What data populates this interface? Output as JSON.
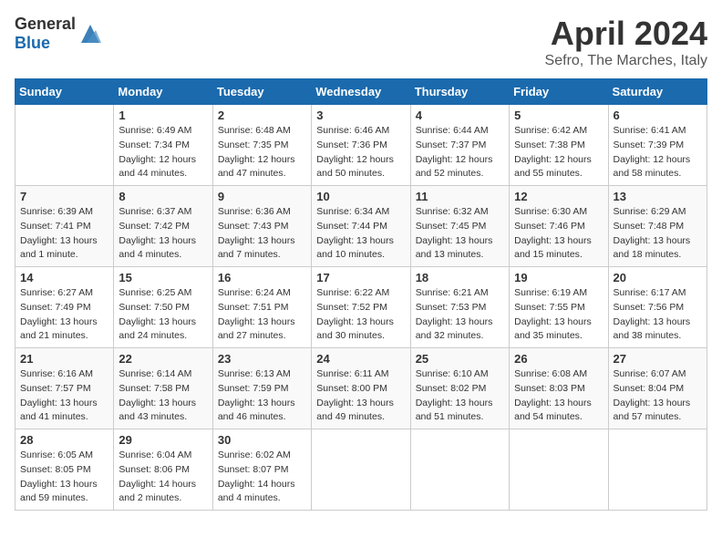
{
  "header": {
    "logo_general": "General",
    "logo_blue": "Blue",
    "month_year": "April 2024",
    "location": "Sefro, The Marches, Italy"
  },
  "weekdays": [
    "Sunday",
    "Monday",
    "Tuesday",
    "Wednesday",
    "Thursday",
    "Friday",
    "Saturday"
  ],
  "weeks": [
    [
      {
        "day": "",
        "sunrise": "",
        "sunset": "",
        "daylight": ""
      },
      {
        "day": "1",
        "sunrise": "Sunrise: 6:49 AM",
        "sunset": "Sunset: 7:34 PM",
        "daylight": "Daylight: 12 hours and 44 minutes."
      },
      {
        "day": "2",
        "sunrise": "Sunrise: 6:48 AM",
        "sunset": "Sunset: 7:35 PM",
        "daylight": "Daylight: 12 hours and 47 minutes."
      },
      {
        "day": "3",
        "sunrise": "Sunrise: 6:46 AM",
        "sunset": "Sunset: 7:36 PM",
        "daylight": "Daylight: 12 hours and 50 minutes."
      },
      {
        "day": "4",
        "sunrise": "Sunrise: 6:44 AM",
        "sunset": "Sunset: 7:37 PM",
        "daylight": "Daylight: 12 hours and 52 minutes."
      },
      {
        "day": "5",
        "sunrise": "Sunrise: 6:42 AM",
        "sunset": "Sunset: 7:38 PM",
        "daylight": "Daylight: 12 hours and 55 minutes."
      },
      {
        "day": "6",
        "sunrise": "Sunrise: 6:41 AM",
        "sunset": "Sunset: 7:39 PM",
        "daylight": "Daylight: 12 hours and 58 minutes."
      }
    ],
    [
      {
        "day": "7",
        "sunrise": "Sunrise: 6:39 AM",
        "sunset": "Sunset: 7:41 PM",
        "daylight": "Daylight: 13 hours and 1 minute."
      },
      {
        "day": "8",
        "sunrise": "Sunrise: 6:37 AM",
        "sunset": "Sunset: 7:42 PM",
        "daylight": "Daylight: 13 hours and 4 minutes."
      },
      {
        "day": "9",
        "sunrise": "Sunrise: 6:36 AM",
        "sunset": "Sunset: 7:43 PM",
        "daylight": "Daylight: 13 hours and 7 minutes."
      },
      {
        "day": "10",
        "sunrise": "Sunrise: 6:34 AM",
        "sunset": "Sunset: 7:44 PM",
        "daylight": "Daylight: 13 hours and 10 minutes."
      },
      {
        "day": "11",
        "sunrise": "Sunrise: 6:32 AM",
        "sunset": "Sunset: 7:45 PM",
        "daylight": "Daylight: 13 hours and 13 minutes."
      },
      {
        "day": "12",
        "sunrise": "Sunrise: 6:30 AM",
        "sunset": "Sunset: 7:46 PM",
        "daylight": "Daylight: 13 hours and 15 minutes."
      },
      {
        "day": "13",
        "sunrise": "Sunrise: 6:29 AM",
        "sunset": "Sunset: 7:48 PM",
        "daylight": "Daylight: 13 hours and 18 minutes."
      }
    ],
    [
      {
        "day": "14",
        "sunrise": "Sunrise: 6:27 AM",
        "sunset": "Sunset: 7:49 PM",
        "daylight": "Daylight: 13 hours and 21 minutes."
      },
      {
        "day": "15",
        "sunrise": "Sunrise: 6:25 AM",
        "sunset": "Sunset: 7:50 PM",
        "daylight": "Daylight: 13 hours and 24 minutes."
      },
      {
        "day": "16",
        "sunrise": "Sunrise: 6:24 AM",
        "sunset": "Sunset: 7:51 PM",
        "daylight": "Daylight: 13 hours and 27 minutes."
      },
      {
        "day": "17",
        "sunrise": "Sunrise: 6:22 AM",
        "sunset": "Sunset: 7:52 PM",
        "daylight": "Daylight: 13 hours and 30 minutes."
      },
      {
        "day": "18",
        "sunrise": "Sunrise: 6:21 AM",
        "sunset": "Sunset: 7:53 PM",
        "daylight": "Daylight: 13 hours and 32 minutes."
      },
      {
        "day": "19",
        "sunrise": "Sunrise: 6:19 AM",
        "sunset": "Sunset: 7:55 PM",
        "daylight": "Daylight: 13 hours and 35 minutes."
      },
      {
        "day": "20",
        "sunrise": "Sunrise: 6:17 AM",
        "sunset": "Sunset: 7:56 PM",
        "daylight": "Daylight: 13 hours and 38 minutes."
      }
    ],
    [
      {
        "day": "21",
        "sunrise": "Sunrise: 6:16 AM",
        "sunset": "Sunset: 7:57 PM",
        "daylight": "Daylight: 13 hours and 41 minutes."
      },
      {
        "day": "22",
        "sunrise": "Sunrise: 6:14 AM",
        "sunset": "Sunset: 7:58 PM",
        "daylight": "Daylight: 13 hours and 43 minutes."
      },
      {
        "day": "23",
        "sunrise": "Sunrise: 6:13 AM",
        "sunset": "Sunset: 7:59 PM",
        "daylight": "Daylight: 13 hours and 46 minutes."
      },
      {
        "day": "24",
        "sunrise": "Sunrise: 6:11 AM",
        "sunset": "Sunset: 8:00 PM",
        "daylight": "Daylight: 13 hours and 49 minutes."
      },
      {
        "day": "25",
        "sunrise": "Sunrise: 6:10 AM",
        "sunset": "Sunset: 8:02 PM",
        "daylight": "Daylight: 13 hours and 51 minutes."
      },
      {
        "day": "26",
        "sunrise": "Sunrise: 6:08 AM",
        "sunset": "Sunset: 8:03 PM",
        "daylight": "Daylight: 13 hours and 54 minutes."
      },
      {
        "day": "27",
        "sunrise": "Sunrise: 6:07 AM",
        "sunset": "Sunset: 8:04 PM",
        "daylight": "Daylight: 13 hours and 57 minutes."
      }
    ],
    [
      {
        "day": "28",
        "sunrise": "Sunrise: 6:05 AM",
        "sunset": "Sunset: 8:05 PM",
        "daylight": "Daylight: 13 hours and 59 minutes."
      },
      {
        "day": "29",
        "sunrise": "Sunrise: 6:04 AM",
        "sunset": "Sunset: 8:06 PM",
        "daylight": "Daylight: 14 hours and 2 minutes."
      },
      {
        "day": "30",
        "sunrise": "Sunrise: 6:02 AM",
        "sunset": "Sunset: 8:07 PM",
        "daylight": "Daylight: 14 hours and 4 minutes."
      },
      {
        "day": "",
        "sunrise": "",
        "sunset": "",
        "daylight": ""
      },
      {
        "day": "",
        "sunrise": "",
        "sunset": "",
        "daylight": ""
      },
      {
        "day": "",
        "sunrise": "",
        "sunset": "",
        "daylight": ""
      },
      {
        "day": "",
        "sunrise": "",
        "sunset": "",
        "daylight": ""
      }
    ]
  ]
}
